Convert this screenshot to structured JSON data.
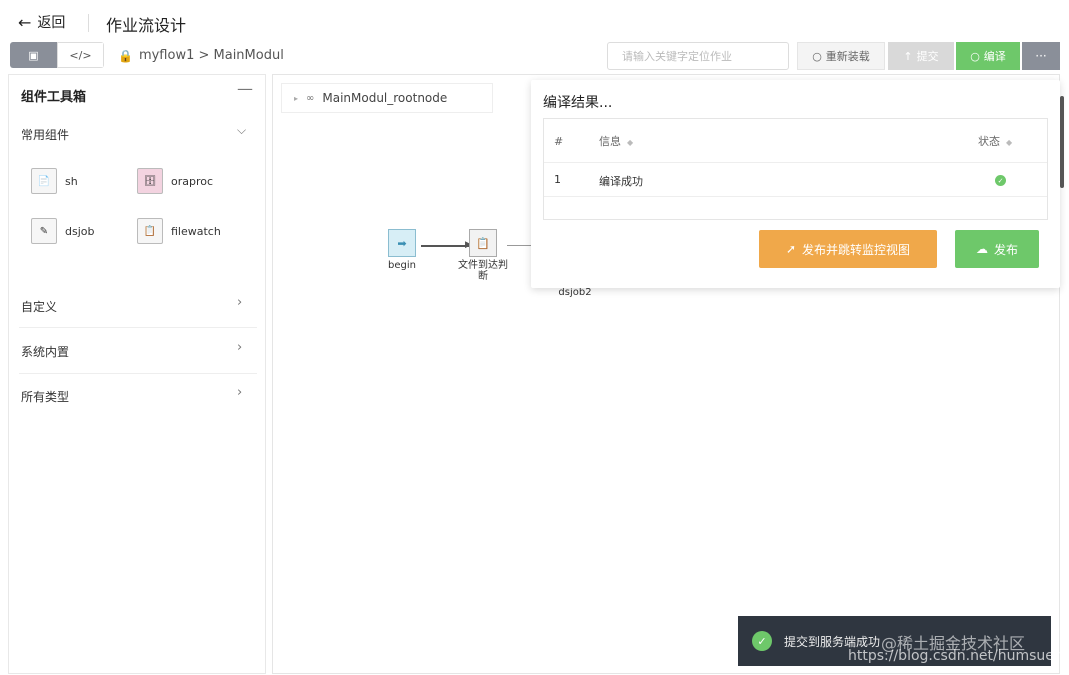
{
  "header": {
    "back_label": "返回",
    "back_icon": "←",
    "title": "作业流设计"
  },
  "toolbar": {
    "view_icons": [
      "▣",
      "</>"
    ],
    "breadcrumb_icon": "🔒",
    "breadcrumb": "myflow1 > MainModul",
    "search_placeholder": "请输入关键字定位作业",
    "reload_icon": "○",
    "reload_label": "重新装载",
    "submit_icon": "↑",
    "submit_label": "提交",
    "compile_icon": "○",
    "compile_label": "编译",
    "more_label": "···"
  },
  "sidebar": {
    "title": "组件工具箱",
    "collapse_icon": "—",
    "common_label": "常用组件",
    "components": [
      {
        "label": "sh",
        "icon": "📄"
      },
      {
        "label": "oraproc",
        "icon": "🗄"
      },
      {
        "label": "dsjob",
        "icon": "✎"
      },
      {
        "label": "filewatch",
        "icon": "📋"
      }
    ],
    "sections": [
      "自定义",
      "系统内置",
      "所有类型"
    ]
  },
  "canvas": {
    "root_node_label": "MainModul_rootnode",
    "nodes": [
      {
        "label": "begin",
        "icon": "➡"
      },
      {
        "label": "文件到达判断",
        "icon": "📋"
      },
      {
        "label": "dsjob2",
        "icon": ""
      }
    ]
  },
  "popup": {
    "title": "编译结果...",
    "columns": [
      "#",
      "信息",
      "状态"
    ],
    "rows": [
      {
        "index": "1",
        "message": "编译成功",
        "status": "✓"
      }
    ],
    "publish_monitor_label": "发布并跳转监控视图",
    "publish_monitor_icon": "➚",
    "publish_label": "发布",
    "publish_icon": "☁"
  },
  "toast": {
    "message": "提交到服务端成功",
    "icon": "✓"
  },
  "watermark": {
    "line1": "@稀土掘金技术社区",
    "line2": "https://blog.csdn.net/humsuer"
  },
  "colors": {
    "green": "#6ec86a",
    "orange": "#f0a84a",
    "gray": "#8a8f99"
  }
}
